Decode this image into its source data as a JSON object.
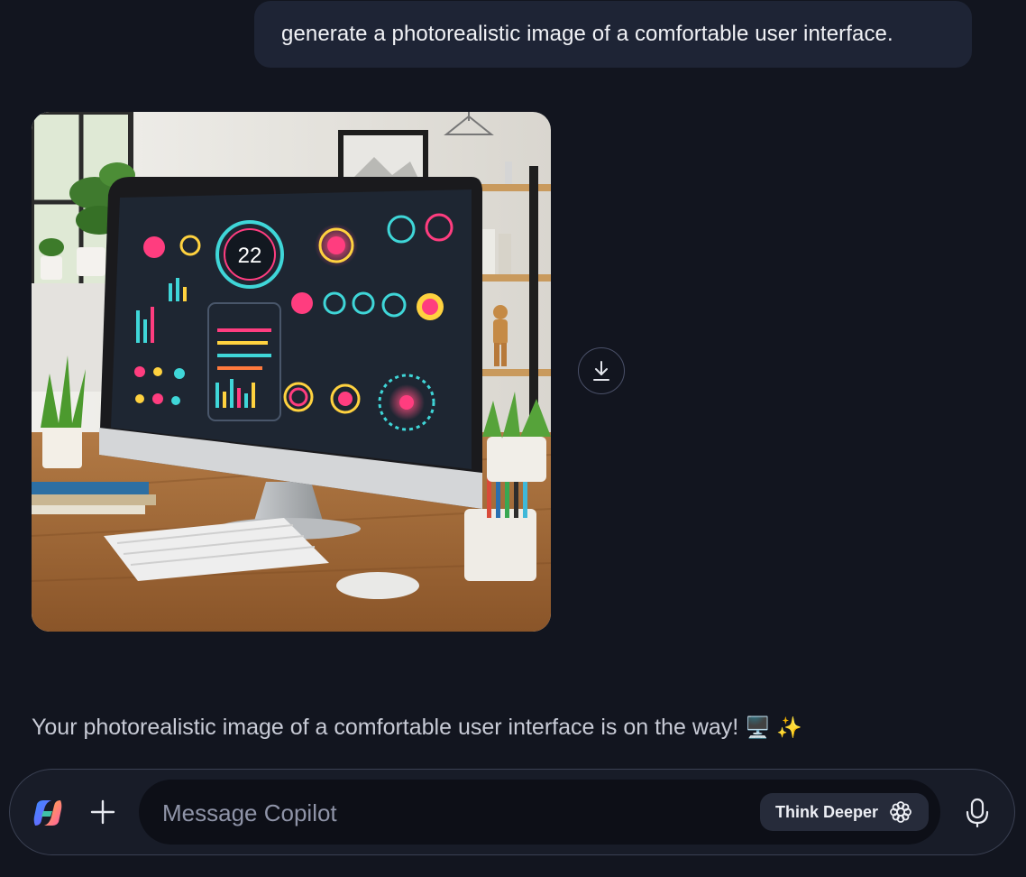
{
  "conversation": {
    "user_message": "generate a photorealistic image of a comfortable user interface.",
    "assistant_text": "Your photorealistic image of a comfortable user interface is on the way!",
    "assistant_emoji": "🖥️ ✨",
    "generated_image": {
      "screen_readout": "22"
    }
  },
  "composer": {
    "placeholder": "Message Copilot",
    "think_deeper_label": "Think Deeper"
  },
  "icons": {
    "logo": "copilot-logo",
    "plus": "plus-icon",
    "download": "download-icon",
    "think": "think-deeper-icon",
    "mic": "microphone-icon"
  },
  "colors": {
    "background": "#12151f",
    "bubble": "#1e2435",
    "composer": "#181c28",
    "input": "#0d0f17",
    "accent_pink": "#ff3d7f",
    "accent_cyan": "#3fd6d8"
  }
}
